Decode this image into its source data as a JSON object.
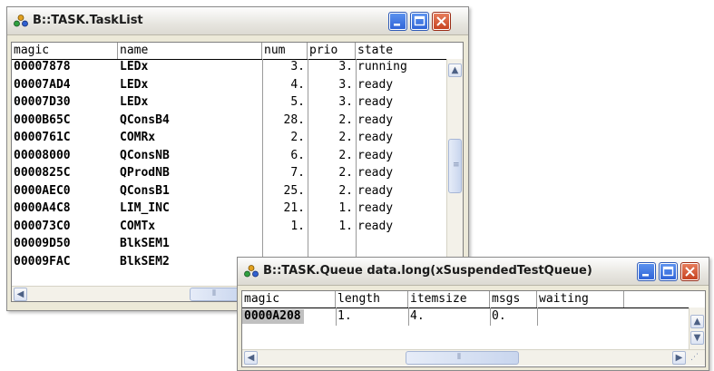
{
  "tasklist_window": {
    "title": "B::TASK.TaskList",
    "columns": [
      "magic",
      "name",
      "num",
      "prio",
      "state"
    ],
    "rows": [
      {
        "magic": "00007878",
        "name": "LEDx",
        "num": "3.",
        "prio": "3.",
        "state": "running"
      },
      {
        "magic": "00007AD4",
        "name": "LEDx",
        "num": "4.",
        "prio": "3.",
        "state": "ready"
      },
      {
        "magic": "00007D30",
        "name": "LEDx",
        "num": "5.",
        "prio": "3.",
        "state": "ready"
      },
      {
        "magic": "0000B65C",
        "name": "QConsB4",
        "num": "28.",
        "prio": "2.",
        "state": "ready"
      },
      {
        "magic": "0000761C",
        "name": "COMRx",
        "num": "2.",
        "prio": "2.",
        "state": "ready"
      },
      {
        "magic": "00008000",
        "name": "QConsNB",
        "num": "6.",
        "prio": "2.",
        "state": "ready"
      },
      {
        "magic": "0000825C",
        "name": "QProdNB",
        "num": "7.",
        "prio": "2.",
        "state": "ready"
      },
      {
        "magic": "0000AEC0",
        "name": "QConsB1",
        "num": "25.",
        "prio": "2.",
        "state": "ready"
      },
      {
        "magic": "0000A4C8",
        "name": "LIM_INC",
        "num": "21.",
        "prio": "1.",
        "state": "ready"
      },
      {
        "magic": "000073C0",
        "name": "COMTx",
        "num": "1.",
        "prio": "1.",
        "state": "ready"
      },
      {
        "magic": "00009D50",
        "name": "BlkSEM1",
        "num": "",
        "prio": "",
        "state": ""
      },
      {
        "magic": "00009FAC",
        "name": "BlkSEM2",
        "num": "",
        "prio": "",
        "state": ""
      }
    ]
  },
  "queue_window": {
    "title": "B::TASK.Queue data.long(xSuspendedTestQueue)",
    "columns": [
      "magic",
      "length",
      "itemsize",
      "msgs",
      "waiting"
    ],
    "rows": [
      {
        "magic": "0000A208",
        "length": "1.",
        "itemsize": "4.",
        "msgs": "0.",
        "waiting": ""
      }
    ]
  },
  "icons": {
    "app": "trace32-app-icon",
    "minimize": "minimize-icon",
    "maximize": "maximize-icon",
    "close": "close-icon",
    "scroll_up": "chevron-up-icon",
    "scroll_down": "chevron-down-icon",
    "scroll_left": "chevron-left-icon",
    "scroll_right": "chevron-right-icon"
  },
  "colors": {
    "title_bg": "#e7e6e0",
    "control_blue": "#2e62d6",
    "close_red": "#c5401e",
    "selection": "#c0c0c0"
  }
}
